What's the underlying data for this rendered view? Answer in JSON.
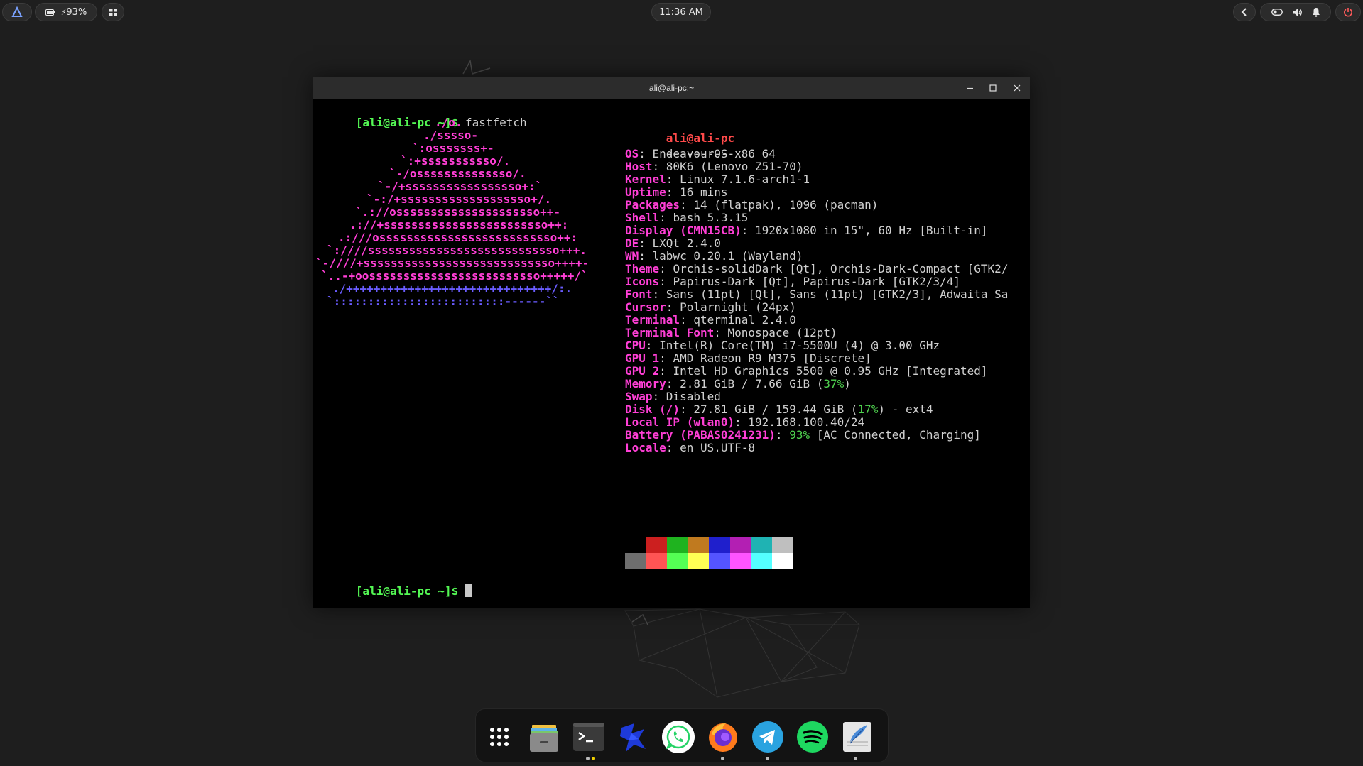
{
  "topbar": {
    "battery_text": "93%",
    "clock": "11:36 AM"
  },
  "window": {
    "title": "ali@ali-pc:~"
  },
  "terminal": {
    "prompt": "[ali@ali-pc ~]$",
    "command": "fastfetch",
    "logo": [
      {
        "t": "./o.",
        "c": "#ff3fd6"
      },
      {
        "t": "./sssso-",
        "c": "#ff3fd6"
      },
      {
        "t": "`:osssssss+-",
        "c": "#ff3fd6"
      },
      {
        "t": "`:+sssssssssso/.",
        "c": "#ff3fd6"
      },
      {
        "t": "`-/ossssssssssssso/.",
        "c": "#ff3fd6"
      },
      {
        "t": "`-/+sssssssssssssssso+:`",
        "c": "#ff3fd6"
      },
      {
        "t": "`-:/+sssssssssssssssssso+/.",
        "c": "#ff3fd6"
      },
      {
        "t": "`.://osssssssssssssssssssso++-",
        "c": "#ff3fd6"
      },
      {
        "t": ".://+ssssssssssssssssssssssso++:",
        "c": "#ff3fd6"
      },
      {
        "t": ".:///ossssssssssssssssssssssssso++:",
        "c": "#ff3fd6"
      },
      {
        "t": "`:////ssssssssssssssssssssssssssso+++.",
        "c": "#ff3fd6"
      },
      {
        "t": "`-////+ssssssssssssssssssssssssssso++++-",
        "c": "#ff3fd6"
      },
      {
        "t": "`..-+oosssssssssssssssssssssssso+++++/`",
        "c": "#ff3fd6"
      },
      {
        "t": "./++++++++++++++++++++++++++++++/:.",
        "c": "#6a5cff"
      },
      {
        "t": "`:::::::::::::::::::::::::------``",
        "c": "#6a5cff"
      }
    ],
    "user_host": "ali@ali-pc",
    "separator": "----------",
    "info": [
      {
        "k": "OS",
        "v": ": EndeavourOS x86_64"
      },
      {
        "k": "Host",
        "v": ": 80K6 (Lenovo Z51-70)"
      },
      {
        "k": "Kernel",
        "v": ": Linux 7.1.6-arch1-1"
      },
      {
        "k": "Uptime",
        "v": ": 16 mins"
      },
      {
        "k": "Packages",
        "v": ": 14 (flatpak), 1096 (pacman)"
      },
      {
        "k": "Shell",
        "v": ": bash 5.3.15"
      },
      {
        "k": "Display (CMN15CB)",
        "v": ": 1920x1080 in 15\", 60 Hz [Built-in]"
      },
      {
        "k": "DE",
        "v": ": LXQt 2.4.0"
      },
      {
        "k": "WM",
        "v": ": labwc 0.20.1 (Wayland)"
      },
      {
        "k": "Theme",
        "v": ": Orchis-solidDark [Qt], Orchis-Dark-Compact [GTK2/"
      },
      {
        "k": "Icons",
        "v": ": Papirus-Dark [Qt], Papirus-Dark [GTK2/3/4]"
      },
      {
        "k": "Font",
        "v": ": Sans (11pt) [Qt], Sans (11pt) [GTK2/3], Adwaita Sa"
      },
      {
        "k": "Cursor",
        "v": ": Polarnight (24px)"
      },
      {
        "k": "Terminal",
        "v": ": qterminal 2.4.0"
      },
      {
        "k": "Terminal Font",
        "v": ": Monospace (12pt)"
      },
      {
        "k": "CPU",
        "v": ": Intel(R) Core(TM) i7-5500U (4) @ 3.00 GHz"
      },
      {
        "k": "GPU 1",
        "v": ": AMD Radeon R9 M375 [Discrete]"
      },
      {
        "k": "GPU 2",
        "v": ": Intel HD Graphics 5500 @ 0.95 GHz [Integrated]"
      },
      {
        "k": "Memory",
        "v": ": 2.81 GiB / 7.66 GiB (",
        "g": "37%",
        "v2": ")"
      },
      {
        "k": "Swap",
        "v": ": Disabled"
      },
      {
        "k": "Disk (/)",
        "v": ": 27.81 GiB / 159.44 GiB (",
        "g": "17%",
        "v2": ") - ext4"
      },
      {
        "k": "Local IP (wlan0)",
        "v": ": 192.168.100.40/24"
      },
      {
        "k": "Battery (PABAS0241231)",
        "v": ": ",
        "g": "93%",
        "v2": " [AC Connected, Charging]"
      },
      {
        "k": "Locale",
        "v": ": en_US.UTF-8"
      }
    ],
    "palette_top": [
      "#000000",
      "#cc1f1f",
      "#1fb31f",
      "#c07a1f",
      "#1f1fcc",
      "#b31fb3",
      "#1fb3b3",
      "#bfbfbf"
    ],
    "palette_bottom": [
      "#6e6e6e",
      "#ff5454",
      "#54ff54",
      "#ffff54",
      "#5454ff",
      "#ff54ff",
      "#54ffff",
      "#ffffff"
    ]
  },
  "dock": {
    "items": [
      "app-grid",
      "files",
      "terminal",
      "tasks",
      "whatsapp",
      "firefox",
      "telegram",
      "spotify",
      "featherpad"
    ]
  }
}
